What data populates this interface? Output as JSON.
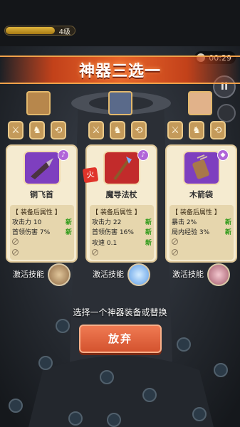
{
  "hud": {
    "level": "4级",
    "xp_fraction": 0.7,
    "timer": "00:29",
    "pause_icon": "pause-icon"
  },
  "title": "神器三选一",
  "cards": [
    {
      "name": "铜飞首",
      "icon": "flying-blade-icon",
      "color": "#7e3fbf",
      "badge": "mic-icon",
      "attr_title": "【 装备后属性 】",
      "attrs": [
        {
          "label": "攻击力 10",
          "tag": "新"
        },
        {
          "label": "首领伤害 7%",
          "tag": "新"
        }
      ],
      "empty_slots": 2,
      "skill_label": "激活技能",
      "skill_color": "#8f6a45"
    },
    {
      "name": "魔导法杖",
      "icon": "magic-staff-icon",
      "color": "#c22b2b",
      "badge": "mic-icon",
      "hot": "火",
      "attr_title": "【 装备后属性 】",
      "attrs": [
        {
          "label": "攻击力 22",
          "tag": "新"
        },
        {
          "label": "首领伤害 16%",
          "tag": "新"
        },
        {
          "label": "攻速 0.1",
          "tag": "新"
        }
      ],
      "empty_slots": 1,
      "skill_label": "激活技能",
      "skill_color": "#5d9ce6"
    },
    {
      "name": "木箭袋",
      "icon": "quiver-icon",
      "color": "#7e3fbf",
      "badge": "gem-icon",
      "attr_title": "【 装备后属性 】",
      "attrs": [
        {
          "label": "暴击 2%",
          "tag": "新"
        },
        {
          "label": "局内经验 3%",
          "tag": "新"
        }
      ],
      "empty_slots": 2,
      "skill_label": "激活技能",
      "skill_color": "#a45b6c"
    }
  ],
  "slot_icons": [
    "dagger-icon",
    "armor-icon",
    "boomerang-icon"
  ],
  "prompt": "选择一个神器装备或替换",
  "give_up": "放弃"
}
